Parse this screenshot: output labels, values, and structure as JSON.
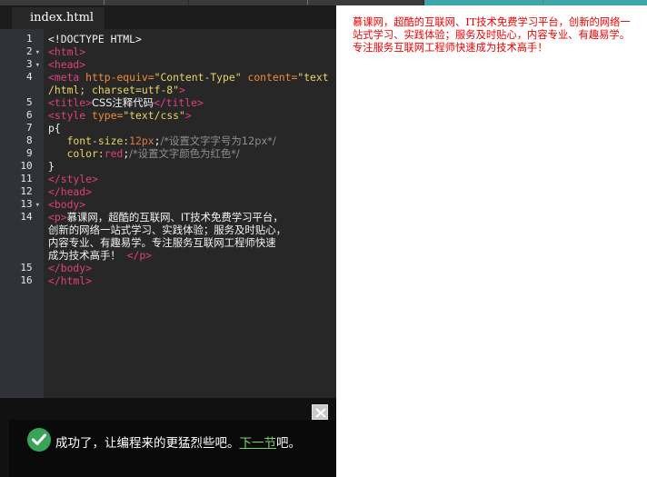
{
  "editor": {
    "tab_label": "index.html",
    "line_numbers": [
      "1",
      "2",
      "3",
      "4",
      "",
      "5",
      "6",
      "7",
      "8",
      "9",
      "10",
      "11",
      "12",
      "13",
      "14",
      "",
      "",
      "",
      "15",
      "16"
    ],
    "code": {
      "l1": "<!DOCTYPE HTML>",
      "l2": "<html>",
      "l3": "<head>",
      "l4a_tag": "<meta",
      "l4a_attr1": "http-equiv=",
      "l4a_val1": "\"Content-Type\"",
      "l4a_attr2": "content=",
      "l4a_val2": "\"text",
      "l4b": "/html; charset=utf-8\"",
      "l4b_close": ">",
      "l5_open": "<title>",
      "l5_text": "CSS注释代码",
      "l5_close": "</title>",
      "l6_tag": "<style",
      "l6_attr": "type=",
      "l6_val": "\"text/css\"",
      "l6_close": ">",
      "l7": "p{",
      "l8_prop": "font-size:",
      "l8_num": "12px",
      "l8_semi": ";",
      "l8_cm": "/*设置文字字号为12px*/",
      "l9_prop": "color:",
      "l9_kw": "red",
      "l9_semi": ";",
      "l9_cm": "/*设置文字颜色为红色*/",
      "l10": "}",
      "l11": "</style>",
      "l12": "</head>",
      "l13": "<body>",
      "l14_open": "<p>",
      "l14_t1": "慕课网，超酷的互联网、IT技术免费学习平台，",
      "l14_t2": "创新的网络一站式学习、实践体验；服务及时贴心，",
      "l14_t3": "内容专业、有趣易学。专注服务互联网工程师快速",
      "l14_t4": "成为技术高手！",
      "l14_close": "</p>",
      "l15": "</body>",
      "l16": "</html>"
    }
  },
  "banner": {
    "message_prefix": "成功了，让编程来的更猛烈些吧。",
    "next_link": "下一节",
    "message_suffix": "吧。"
  },
  "preview": {
    "paragraph": "慕课网，超酷的互联网、IT技术免费学习平台，创新的网络一站式学习、实践体验；服务及时贴心，内容专业、有趣易学。专注服务互联网工程师快速成为技术高手！"
  },
  "colors": {
    "editor_bg": "#272727",
    "gutter_bg": "#2f3236",
    "tag": "#e0407a",
    "attribute": "#f08a3a",
    "string": "#e8d466",
    "comment": "#8e8e8e",
    "success_green": "#3aa35a",
    "preview_text": "#ee0000",
    "top_strip_accent": "#3ca6a8"
  }
}
